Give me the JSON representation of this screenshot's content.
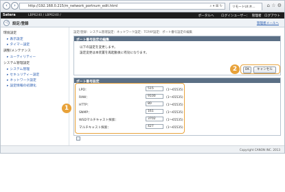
{
  "browser": {
    "url": "http://192.168.0.215/m_network_portnum_edit.html",
    "tab_title": "リモートUI:ネ...",
    "back_icon": "back-arrow-icon",
    "forward_icon": "forward-arrow-icon"
  },
  "header": {
    "brand": "Satera",
    "model": "LBP6240 / LBP6240 /",
    "links": [
      "ポータルへ",
      "ログインユーザー：",
      "管理者",
      "ログアウト"
    ]
  },
  "titlebar": {
    "title": "設定/登録",
    "right_link": "管理者メールへ"
  },
  "sidebar": {
    "items": [
      {
        "label": "環境設定",
        "type": "head"
      },
      {
        "label": "表示設定",
        "type": "link"
      },
      {
        "label": "タイマー設定",
        "type": "link"
      },
      {
        "label": "調整/メンテナンス",
        "type": "head"
      },
      {
        "label": "ユーティリティー",
        "type": "link"
      },
      {
        "label": "システム管理設定",
        "type": "head"
      },
      {
        "label": "システム管理",
        "type": "link"
      },
      {
        "label": "セキュリティー設定",
        "type": "link"
      },
      {
        "label": "ネットワーク設定",
        "type": "link"
      },
      {
        "label": "設定情報の初期化",
        "type": "link"
      }
    ]
  },
  "breadcrumb": "設定/登録：システム管理設定：ネットワーク設定：TCP/IP設定：ポート番号設定の編集",
  "edit_panel": {
    "title": "ポート番号設定の編集",
    "message_line1": "以下の設定を変更します。",
    "message_line2": "設定変更は本装置を再起動後に有効になります。",
    "ok_label": "OK",
    "cancel_label": "キャンセル"
  },
  "port_panel": {
    "title": "ポート番号設定",
    "rows": [
      {
        "label": "LPD：",
        "value": "515",
        "range": "(1〜65535)"
      },
      {
        "label": "RAW：",
        "value": "9100",
        "range": "(1〜65535)"
      },
      {
        "label": "HTTP：",
        "value": "80",
        "range": "(1〜65535)"
      },
      {
        "label": "SNMP：",
        "value": "161",
        "range": "(1〜65535)"
      },
      {
        "label": "WSDマルチキャスト探索：",
        "value": "3702",
        "range": "(1〜65535)"
      },
      {
        "label": "マルチキャスト探索：",
        "value": "427",
        "range": "(1〜65535)"
      }
    ]
  },
  "callouts": {
    "one": "1",
    "two": "2"
  },
  "footer": {
    "copyright": "Copyright CANON INC. 2013"
  },
  "colors": {
    "accent": "#e8a23a",
    "panel_header": "#5b6f85",
    "header_bar": "#1e1e1e"
  }
}
